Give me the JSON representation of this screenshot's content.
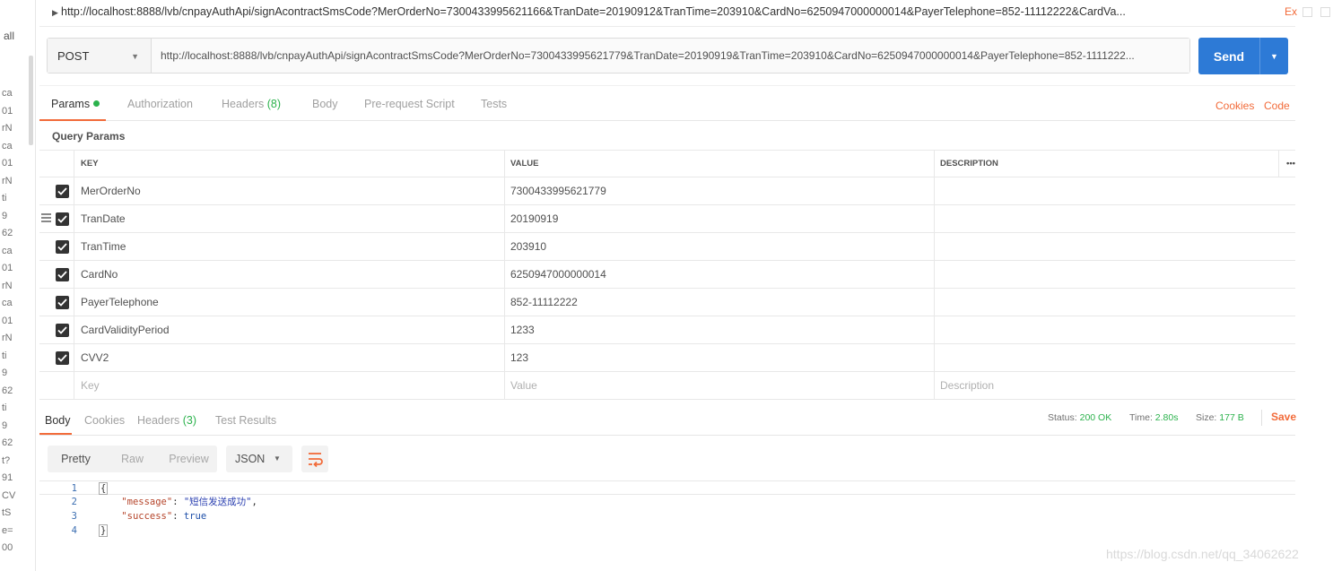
{
  "sidebar": {
    "all_label": "all",
    "fragments": [
      "ca",
      "01",
      "rN",
      "ca",
      "01",
      "rN",
      "ti",
      "9",
      "62",
      "ca",
      "01",
      "rN",
      "ca",
      "01",
      "rN",
      "ti",
      "9",
      "62",
      "ti",
      "9",
      "62",
      "t?",
      "91",
      "CV",
      "tS",
      "e=",
      "00"
    ]
  },
  "top": {
    "url": "http://localhost:8888/lvb/cnpayAuthApi/signAcontractSmsCode?MerOrderNo=7300433995621166&TranDate=20190912&TranTime=203910&CardNo=6250947000000014&PayerTelephone=852-11112222&CardVa...",
    "ex_label": "Ex"
  },
  "request": {
    "method": "POST",
    "url": "http://localhost:8888/lvb/cnpayAuthApi/signAcontractSmsCode?MerOrderNo=7300433995621779&TranDate=20190919&TranTime=203910&CardNo=6250947000000014&PayerTelephone=852-1111222...",
    "send_label": "Send"
  },
  "tabs": {
    "params": "Params",
    "authorization": "Authorization",
    "headers": "Headers",
    "headers_count": "(8)",
    "body": "Body",
    "prerequest": "Pre-request Script",
    "tests": "Tests",
    "cookies": "Cookies",
    "code": "Code"
  },
  "query_params": {
    "title": "Query Params",
    "columns": {
      "key": "KEY",
      "value": "VALUE",
      "description": "DESCRIPTION",
      "more": "•••"
    },
    "rows": [
      {
        "key": "MerOrderNo",
        "value": "7300433995621779",
        "checked": true
      },
      {
        "key": "TranDate",
        "value": "20190919",
        "checked": true
      },
      {
        "key": "TranTime",
        "value": "203910",
        "checked": true
      },
      {
        "key": "CardNo",
        "value": "6250947000000014",
        "checked": true
      },
      {
        "key": "PayerTelephone",
        "value": "852-11112222",
        "checked": true
      },
      {
        "key": "CardValidityPeriod",
        "value": "1233",
        "checked": true
      },
      {
        "key": "CVV2",
        "value": "123",
        "checked": true
      }
    ],
    "placeholder": {
      "key": "Key",
      "value": "Value",
      "description": "Description"
    }
  },
  "response": {
    "tabs": {
      "body": "Body",
      "cookies": "Cookies",
      "headers": "Headers",
      "headers_count": "(3)",
      "test_results": "Test Results"
    },
    "status_label": "Status:",
    "status": "200 OK",
    "time_label": "Time:",
    "time": "2.80s",
    "size_label": "Size:",
    "size": "177 B",
    "save_label": "Save",
    "view_modes": {
      "pretty": "Pretty",
      "raw": "Raw",
      "preview": "Preview"
    },
    "format": "JSON",
    "code": {
      "line_numbers": [
        "1",
        "2",
        "3",
        "4"
      ],
      "open": "{",
      "close": "}",
      "message_key": "\"message\"",
      "message_value": "\"短信发送成功\"",
      "success_key": "\"success\"",
      "success_value": "true"
    }
  },
  "watermark": "https://blog.csdn.net/qq_34062622",
  "colors": {
    "accent": "#f26b3a",
    "send": "#2d7ad6",
    "ok": "#2bb24c"
  }
}
